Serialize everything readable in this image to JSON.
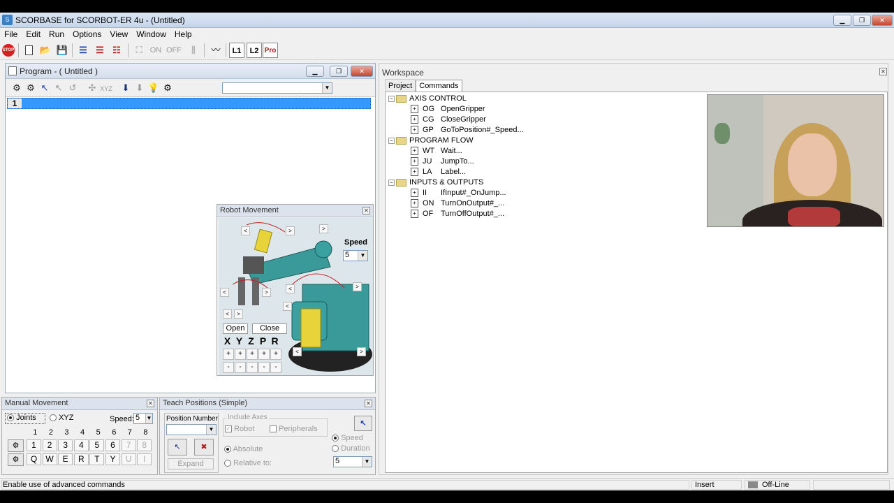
{
  "app": {
    "title": "SCORBASE for SCORBOT-ER 4u - (Untitled)",
    "icon": "app-icon"
  },
  "menu": [
    "File",
    "Edit",
    "Run",
    "Options",
    "View",
    "Window",
    "Help"
  ],
  "toolbar": {
    "on_label": "ON",
    "off_label": "OFF",
    "l1_label": "L1",
    "l2_label": "L2",
    "pro_label": "Pro",
    "stop_label": "STOP"
  },
  "program": {
    "title": "Program - ( Untitled )",
    "line_number": "1"
  },
  "robot_movement": {
    "title": "Robot Movement",
    "speed_label": "Speed",
    "speed_value": "5",
    "open_label": "Open",
    "close_label": "Close",
    "axes": [
      "X",
      "Y",
      "Z",
      "P",
      "R"
    ],
    "plus": "+",
    "minus": "-"
  },
  "workspace": {
    "title": "Workspace",
    "tabs": [
      "Project",
      "Commands"
    ],
    "tree": [
      {
        "group": "AXIS CONTROL",
        "items": [
          [
            "OG",
            "OpenGripper"
          ],
          [
            "CG",
            "CloseGripper"
          ],
          [
            "GP",
            "GoToPosition#_Speed..."
          ]
        ]
      },
      {
        "group": "PROGRAM FLOW",
        "items": [
          [
            "WT",
            "Wait..."
          ],
          [
            "JU",
            "JumpTo..."
          ],
          [
            "LA",
            "Label..."
          ]
        ]
      },
      {
        "group": "INPUTS & OUTPUTS",
        "items": [
          [
            "II",
            "IfInput#_OnJump..."
          ],
          [
            "ON",
            "TurnOnOutput#_..."
          ],
          [
            "OF",
            "TurnOffOutput#_..."
          ]
        ]
      }
    ]
  },
  "manual": {
    "title": "Manual Movement",
    "joints_label": "Joints",
    "xyz_label": "XYZ",
    "speed_label": "Speed:",
    "speed_value": "5",
    "numbers": [
      "1",
      "2",
      "3",
      "4",
      "5",
      "6",
      "7",
      "8"
    ],
    "row1": [
      "1",
      "2",
      "3",
      "4",
      "5",
      "6",
      "7",
      "8"
    ],
    "row2": [
      "Q",
      "W",
      "E",
      "R",
      "T",
      "Y",
      "U",
      "I"
    ]
  },
  "teach": {
    "title": "Teach Positions (Simple)",
    "position_number_label": "Position Number",
    "include_axes_label": "Include Axes",
    "robot_label": "Robot",
    "peripherals_label": "Peripherals",
    "absolute_label": "Absolute",
    "relative_label": "Relative to:",
    "expand_label": "Expand",
    "speed_label": "Speed",
    "duration_label": "Duration",
    "speed_value": "5"
  },
  "status": {
    "message": "Enable use of advanced commands",
    "mode": "Insert",
    "connection": "Off-Line"
  },
  "colors": {
    "selection": "#3399ff",
    "title_gradient": "#c6d6ea",
    "robot_teal": "#3a9a9a",
    "robot_yellow": "#e8d33a"
  }
}
